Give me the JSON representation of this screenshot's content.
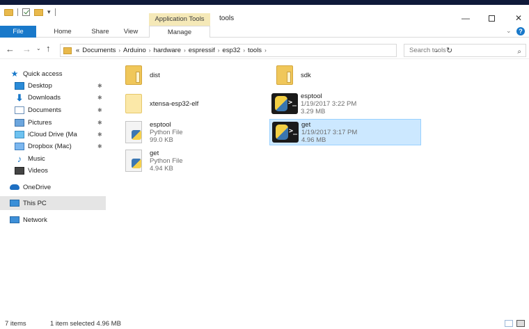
{
  "window": {
    "title": "tools",
    "context_tab_group": "Application Tools",
    "min_glyph": "—",
    "close_glyph": "✕"
  },
  "ribbon": {
    "tabs": [
      "File",
      "Home",
      "Share",
      "View",
      "Manage"
    ],
    "expand_glyph": "⌄",
    "help_glyph": "?"
  },
  "nav": {
    "back_glyph": "←",
    "forward_glyph": "→",
    "recent_glyph": "⌄",
    "up_glyph": "↑",
    "overflow": "«",
    "breadcrumbs": [
      "Documents",
      "Arduino",
      "hardware",
      "espressif",
      "esp32",
      "tools"
    ],
    "crumb_sep": "›",
    "dropdown_glyph": "⌄",
    "refresh_glyph": "↻",
    "search_placeholder": "Search tools",
    "search_glyph": "⌕"
  },
  "sidebar": {
    "pin_glyph": "✱",
    "items": [
      {
        "label": "Quick access"
      },
      {
        "label": "Desktop"
      },
      {
        "label": "Downloads"
      },
      {
        "label": "Documents"
      },
      {
        "label": "Pictures"
      },
      {
        "label": "iCloud Drive (Ma"
      },
      {
        "label": "Dropbox (Mac)"
      },
      {
        "label": "Music"
      },
      {
        "label": "Videos"
      },
      {
        "label": "OneDrive"
      },
      {
        "label": "This PC"
      },
      {
        "label": "Network"
      }
    ]
  },
  "files": [
    {
      "name": "dist",
      "type": "",
      "detail": ""
    },
    {
      "name": "sdk",
      "type": "",
      "detail": ""
    },
    {
      "name": "xtensa-esp32-elf",
      "type": "",
      "detail": ""
    },
    {
      "name": "esptool",
      "type": "1/19/2017 3:22 PM",
      "detail": "3.29 MB"
    },
    {
      "name": "esptool",
      "type": "Python File",
      "detail": "99.0 KB"
    },
    {
      "name": "get",
      "type": "1/19/2017 3:17 PM",
      "detail": "4.96 MB"
    },
    {
      "name": "get",
      "type": "Python File",
      "detail": "4.94 KB"
    }
  ],
  "status": {
    "count": "7 items",
    "selection": "1 item selected  4.96 MB"
  }
}
